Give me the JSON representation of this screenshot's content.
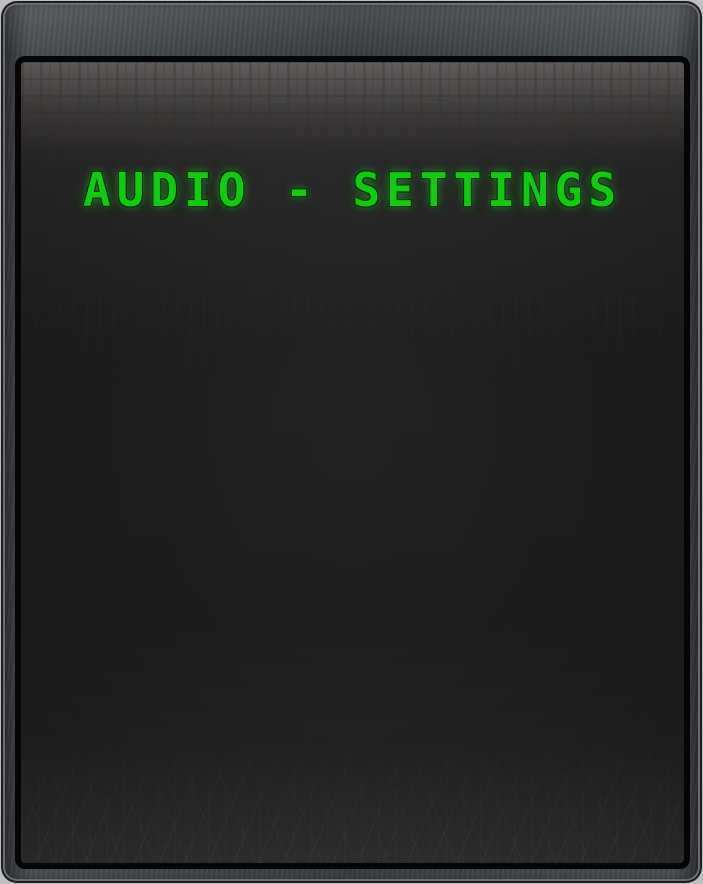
{
  "screen": {
    "title": "AUDIO - SETTINGS"
  },
  "colors": {
    "title_text": "#14c814",
    "panel_background": "#262626",
    "frame_metal": "#3a3c3f"
  }
}
